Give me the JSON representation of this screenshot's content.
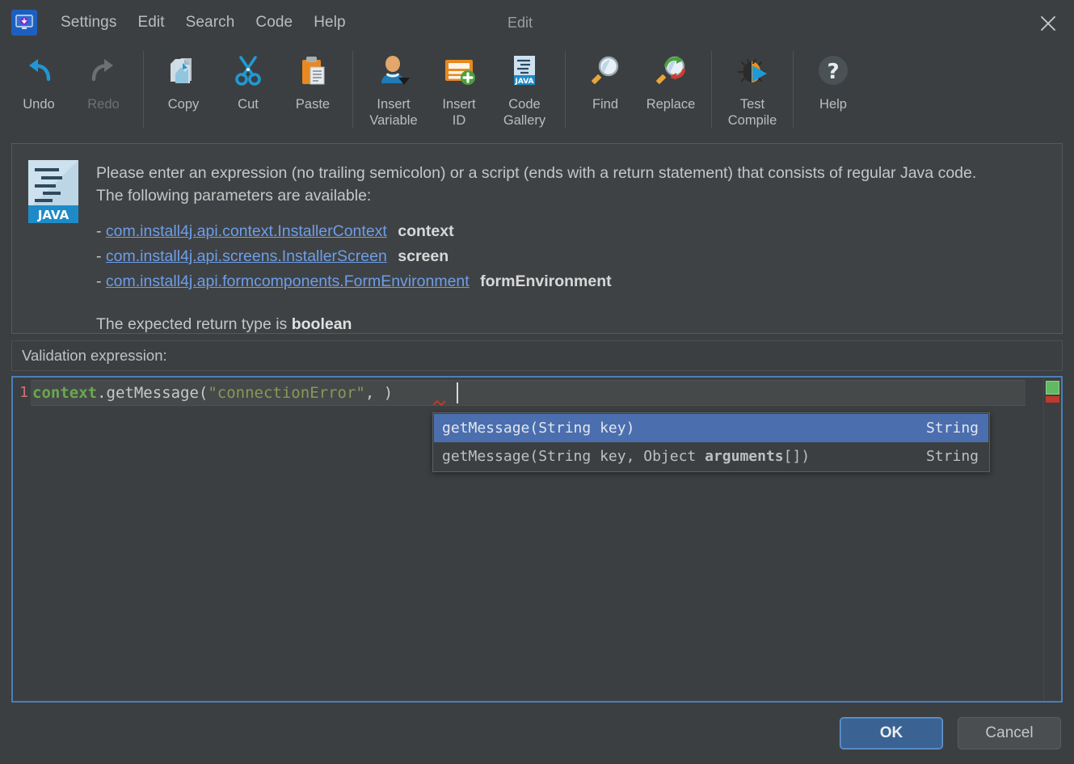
{
  "window": {
    "title": "Edit",
    "app_icon": "installer-monitor-icon",
    "close_icon": "close-icon"
  },
  "menubar": {
    "items": [
      {
        "label": "Settings",
        "name": "menu-settings"
      },
      {
        "label": "Edit",
        "name": "menu-edit"
      },
      {
        "label": "Search",
        "name": "menu-search"
      },
      {
        "label": "Code",
        "name": "menu-code"
      },
      {
        "label": "Help",
        "name": "menu-help"
      }
    ]
  },
  "toolbar": {
    "buttons": [
      {
        "label": "Undo",
        "icon": "undo-arrow-icon",
        "enabled": true
      },
      {
        "label": "Redo",
        "icon": "redo-arrow-icon",
        "enabled": false
      },
      {
        "label": "Copy",
        "icon": "copy-document-icon",
        "enabled": true
      },
      {
        "label": "Cut",
        "icon": "scissors-icon",
        "enabled": true
      },
      {
        "label": "Paste",
        "icon": "clipboard-paste-icon",
        "enabled": true
      },
      {
        "label": "Insert\nVariable",
        "label_line1": "Insert",
        "label_line2": "Variable",
        "icon": "user-variable-icon",
        "enabled": true
      },
      {
        "label_line1": "Insert",
        "label_line2": "ID",
        "icon": "insert-id-plus-icon",
        "enabled": true
      },
      {
        "label_line1": "Code",
        "label_line2": "Gallery",
        "icon": "java-gallery-icon",
        "enabled": true
      },
      {
        "label": "Find",
        "icon": "magnifier-icon",
        "enabled": true
      },
      {
        "label": "Replace",
        "icon": "magnifier-replace-icon",
        "enabled": true
      },
      {
        "label_line1": "Test",
        "label_line2": "Compile",
        "icon": "bug-compile-icon",
        "enabled": true
      },
      {
        "label": "Help",
        "icon": "question-mark-icon",
        "enabled": true
      }
    ]
  },
  "info": {
    "badge_icon": "java-file-icon",
    "badge_text": "JAVA",
    "line1": "Please enter an expression (no trailing semicolon) or a script (ends with a return statement) that consists of regular Java code.",
    "line2": "The following parameters are available:",
    "params": [
      {
        "dash": "-",
        "type": "com.install4j.api.context.InstallerContext",
        "name": "context"
      },
      {
        "dash": "-",
        "type": "com.install4j.api.screens.InstallerScreen",
        "name": "screen"
      },
      {
        "dash": "-",
        "type": "com.install4j.api.formcomponents.FormEnvironment",
        "name": "formEnvironment"
      }
    ],
    "return_prefix": "The expected return type is ",
    "return_type": "boolean"
  },
  "editor": {
    "label": "Validation expression:",
    "line_number": "1",
    "code_tokens": {
      "variable": "context",
      "dot_method": ".getMessage(",
      "string": "\"connectionError\"",
      "comma": ",",
      "close": " )"
    },
    "marker_ok_color": "#62b962",
    "marker_error_color": "#c0392b"
  },
  "autocomplete": {
    "items": [
      {
        "signature_pre": "getMessage(String key)",
        "signature_bold": "",
        "signature_post": "",
        "type": "String",
        "selected": true
      },
      {
        "signature_pre": "getMessage(String key, Object ",
        "signature_bold": "arguments",
        "signature_post": "[])",
        "type": "String",
        "selected": false
      }
    ]
  },
  "footer": {
    "ok_label": "OK",
    "cancel_label": "Cancel"
  },
  "colors": {
    "accent": "#4a7ebb",
    "selection": "#4b6eaf",
    "link": "#6d9ee8",
    "background": "#3c3f41",
    "keyword_green": "#6aa84f",
    "string_olive": "#8d9657"
  }
}
